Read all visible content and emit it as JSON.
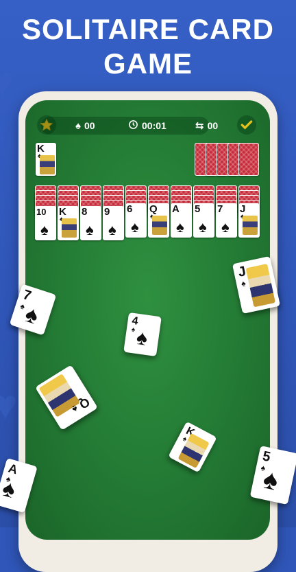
{
  "headline": {
    "line1": "SOLITAIRE CARD",
    "line2": "GAME"
  },
  "colors": {
    "background": "#2f56b8",
    "felt": "#237a34",
    "card_back": "#c72a38",
    "star": "#f6c419",
    "check": "#e6c21f"
  },
  "topbar": {
    "favorite_icon": "star-icon",
    "moves": {
      "icon": "spade-icon",
      "value": "00"
    },
    "time": {
      "icon": "clock-icon",
      "value": "00:01"
    },
    "swaps": {
      "icon": "swap-arrows-icon",
      "value": "00"
    },
    "confirm_icon": "check-icon"
  },
  "foundation": {
    "rank": "K",
    "suit": "♠"
  },
  "stock": {
    "remaining_piles": 5
  },
  "tableau": [
    {
      "rank": "10",
      "suit": "♠"
    },
    {
      "rank": "K",
      "suit": "♠"
    },
    {
      "rank": "8",
      "suit": "♠"
    },
    {
      "rank": "9",
      "suit": "♠"
    },
    {
      "rank": "6",
      "suit": "♠"
    },
    {
      "rank": "Q",
      "suit": "♠"
    },
    {
      "rank": "A",
      "suit": "♠"
    },
    {
      "rank": "5",
      "suit": "♠"
    },
    {
      "rank": "7",
      "suit": "♠"
    },
    {
      "rank": "J",
      "suit": "♠"
    }
  ],
  "floating_cards": [
    {
      "rank": "7",
      "suit": "♠"
    },
    {
      "rank": "J",
      "suit": "♠"
    },
    {
      "rank": "4",
      "suit": "♠"
    },
    {
      "rank": "Q",
      "suit": "♠"
    },
    {
      "rank": "K",
      "suit": "♠"
    },
    {
      "rank": "A",
      "suit": "♠"
    },
    {
      "rank": "5",
      "suit": "♠"
    }
  ]
}
